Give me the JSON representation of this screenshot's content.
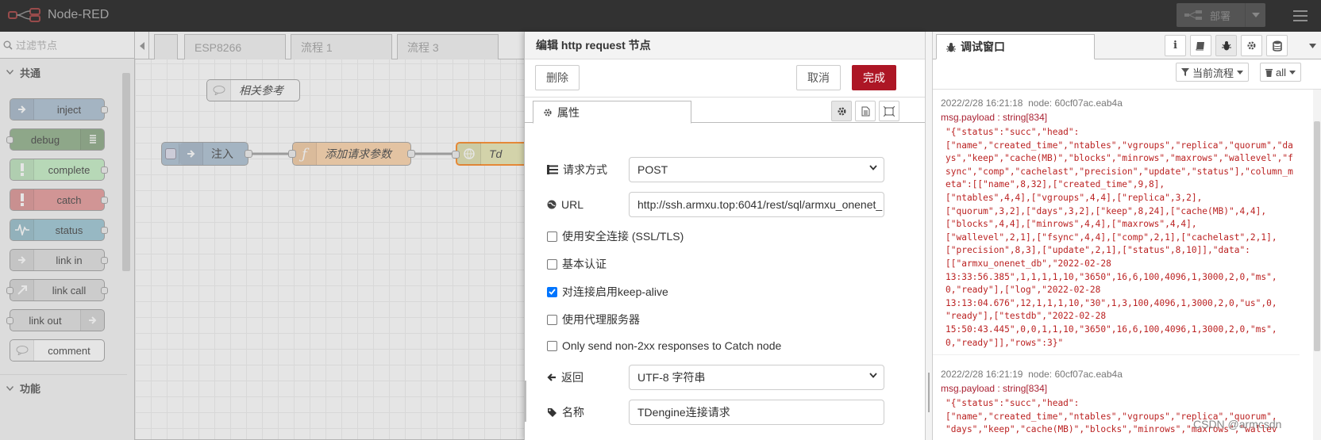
{
  "app": {
    "title": "Node-RED",
    "deploy_label": "部署"
  },
  "palette": {
    "search_placeholder": "过滤节点",
    "categories": [
      {
        "label": "共通"
      },
      {
        "label": "功能"
      }
    ],
    "nodes": [
      {
        "label": "inject",
        "color": "#a6bbcf"
      },
      {
        "label": "debug",
        "color": "#87a980"
      },
      {
        "label": "complete",
        "color": "#c0edc0"
      },
      {
        "label": "catch",
        "color": "#e49191"
      },
      {
        "label": "status",
        "color": "#94c1d0"
      },
      {
        "label": "link in",
        "color": "#dddddd"
      },
      {
        "label": "link call",
        "color": "#dddddd"
      },
      {
        "label": "link out",
        "color": "#dddddd"
      },
      {
        "label": "comment",
        "color": "#ffffff"
      }
    ]
  },
  "workspace": {
    "tabs": [
      "",
      "ESP8266",
      "流程 1",
      "流程 3"
    ],
    "nodes": [
      {
        "label": "相关参考",
        "color": "#ffffff"
      },
      {
        "label": "注入",
        "color": "#a6bbcf"
      },
      {
        "label": "添加请求参数",
        "color": "#fdd0a2"
      },
      {
        "label": "Td",
        "color": "#e7e7ae"
      }
    ]
  },
  "editor": {
    "title": "编辑 http request 节点",
    "delete_label": "删除",
    "cancel_label": "取消",
    "done_label": "完成",
    "properties_tab": "属性",
    "method_label": "请求方式",
    "method_value": "POST",
    "url_label": "URL",
    "url_value": "http://ssh.armxu.top:6041/rest/sql/armxu_onenet_",
    "tls_label": "使用安全连接 (SSL/TLS)",
    "tls_checked": false,
    "basic_auth_label": "基本认证",
    "basic_auth_checked": false,
    "keepalive_label": "对连接启用keep-alive",
    "keepalive_checked": true,
    "proxy_label": "使用代理服务器",
    "proxy_checked": false,
    "non2xx_label": "Only send non-2xx responses to Catch node",
    "non2xx_checked": false,
    "return_label": "返回",
    "return_value": "UTF-8 字符串",
    "name_label": "名称",
    "name_value": "TDengine连接请求"
  },
  "sidebar": {
    "tab_label": "调试窗口",
    "filter_label": "当前流程",
    "clear_label": "all",
    "messages": [
      {
        "time": "2022/2/28 16:21:18",
        "node": "node: 60cf07ac.eab4a",
        "topic": "msg.payload : string[834]",
        "payload": "\"{\"status\":\"succ\",\"head\":\n[\"name\",\"created_time\",\"ntables\",\"vgroups\",\"replica\",\"quorum\",\"days\",\"keep\",\"cache(MB)\",\"blocks\",\"minrows\",\"maxrows\",\"wallevel\",\"fsync\",\"comp\",\"cachelast\",\"precision\",\"update\",\"status\"],\"column_meta\":[[\"name\",8,32],[\"created_time\",9,8],\n[\"ntables\",4,4],[\"vgroups\",4,4],[\"replica\",3,2],\n[\"quorum\",3,2],[\"days\",3,2],[\"keep\",8,24],[\"cache(MB)\",4,4],\n[\"blocks\",4,4],[\"minrows\",4,4],[\"maxrows\",4,4],\n[\"wallevel\",2,1],[\"fsync\",4,4],[\"comp\",2,1],[\"cachelast\",2,1],\n[\"precision\",8,3],[\"update\",2,1],[\"status\",8,10]],\"data\":\n[[\"armxu_onenet_db\",\"2022-02-28\n13:33:56.385\",1,1,1,1,10,\"3650\",16,6,100,4096,1,3000,2,0,\"ms\",\n0,\"ready\"],[\"log\",\"2022-02-28\n13:13:04.676\",12,1,1,1,10,\"30\",1,3,100,4096,1,3000,2,0,\"us\",0,\n\"ready\"],[\"testdb\",\"2022-02-28\n15:50:43.445\",0,0,1,1,10,\"3650\",16,6,100,4096,1,3000,2,0,\"ms\",\n0,\"ready\"]],\"rows\":3}\""
      },
      {
        "time": "2022/2/28 16:21:19",
        "node": "node: 60cf07ac.eab4a",
        "topic": "msg.payload : string[834]",
        "payload": "\"{\"status\":\"succ\",\"head\":\n[\"name\",\"created_time\",\"ntables\",\"vgroups\",\"replica\",\"quorum\",\n\"days\",\"keep\",\"cache(MB)\",\"blocks\",\"minrows\",\"maxrows\",\"wallev"
      }
    ]
  },
  "watermark": "CSDN @armcsdn"
}
